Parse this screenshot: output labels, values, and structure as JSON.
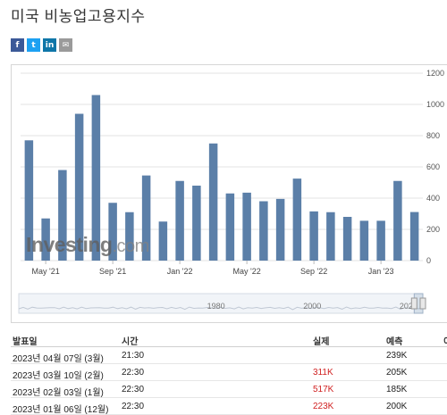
{
  "page": {
    "title": "미국 비농업고용지수"
  },
  "share": [
    {
      "name": "facebook-share-button",
      "glyph": "f",
      "color": "#3b5998"
    },
    {
      "name": "twitter-share-button",
      "glyph": "t",
      "color": "#1da1f2"
    },
    {
      "name": "linkedin-share-button",
      "glyph": "in",
      "color": "#0e76a8"
    },
    {
      "name": "email-share-button",
      "glyph": "✉",
      "color": "#9a9a9a"
    }
  ],
  "watermark": {
    "brand": "Investing",
    "suffix": ".com"
  },
  "chart_data": {
    "type": "bar",
    "title": "",
    "xlabel": "",
    "ylabel": "",
    "ylim": [
      0,
      1200
    ],
    "yticks": [
      0,
      200,
      400,
      600,
      800,
      1000,
      1200
    ],
    "grid": true,
    "axis_side": "right",
    "bar_color": "#5b7fa8",
    "categories": [
      "2021-04",
      "2021-05",
      "2021-06",
      "2021-07",
      "2021-08",
      "2021-09",
      "2021-10",
      "2021-11",
      "2021-12",
      "2022-01",
      "2022-02",
      "2022-03",
      "2022-04",
      "2022-05",
      "2022-06",
      "2022-07",
      "2022-08",
      "2022-09",
      "2022-10",
      "2022-11",
      "2022-12",
      "2023-01",
      "2023-02",
      "2023-03"
    ],
    "values": [
      770,
      270,
      580,
      940,
      1060,
      370,
      310,
      545,
      250,
      510,
      480,
      750,
      430,
      435,
      380,
      395,
      525,
      315,
      310,
      280,
      255,
      255,
      510,
      311
    ],
    "xtick_labels": [
      {
        "category": "2021-05",
        "label": "May '21"
      },
      {
        "category": "2021-09",
        "label": "Sep '21"
      },
      {
        "category": "2022-01",
        "label": "Jan '22"
      },
      {
        "category": "2022-05",
        "label": "May '22"
      },
      {
        "category": "2022-09",
        "label": "Sep '22"
      },
      {
        "category": "2023-01",
        "label": "Jan '23"
      }
    ],
    "navigator": {
      "labels": [
        "1980",
        "2000",
        "2020"
      ],
      "range": [
        1939,
        2023
      ],
      "label_years": [
        1980,
        2000,
        2020
      ]
    }
  },
  "table": {
    "headers": {
      "date": "발표일",
      "time": "시간",
      "actual": "실제",
      "forecast": "예측",
      "previous": "이"
    },
    "rows": [
      {
        "date": "2023년 04월 07일 (3월)",
        "time": "21:30",
        "actual": "",
        "forecast": "239K",
        "actual_color": ""
      },
      {
        "date": "2023년 03월 10일 (2월)",
        "time": "22:30",
        "actual": "311K",
        "forecast": "205K",
        "actual_color": "red"
      },
      {
        "date": "2023년 02월 03일 (1월)",
        "time": "22:30",
        "actual": "517K",
        "forecast": "185K",
        "actual_color": "red"
      },
      {
        "date": "2023년 01월 06일 (12월)",
        "time": "22:30",
        "actual": "223K",
        "forecast": "200K",
        "actual_color": "red"
      }
    ]
  }
}
